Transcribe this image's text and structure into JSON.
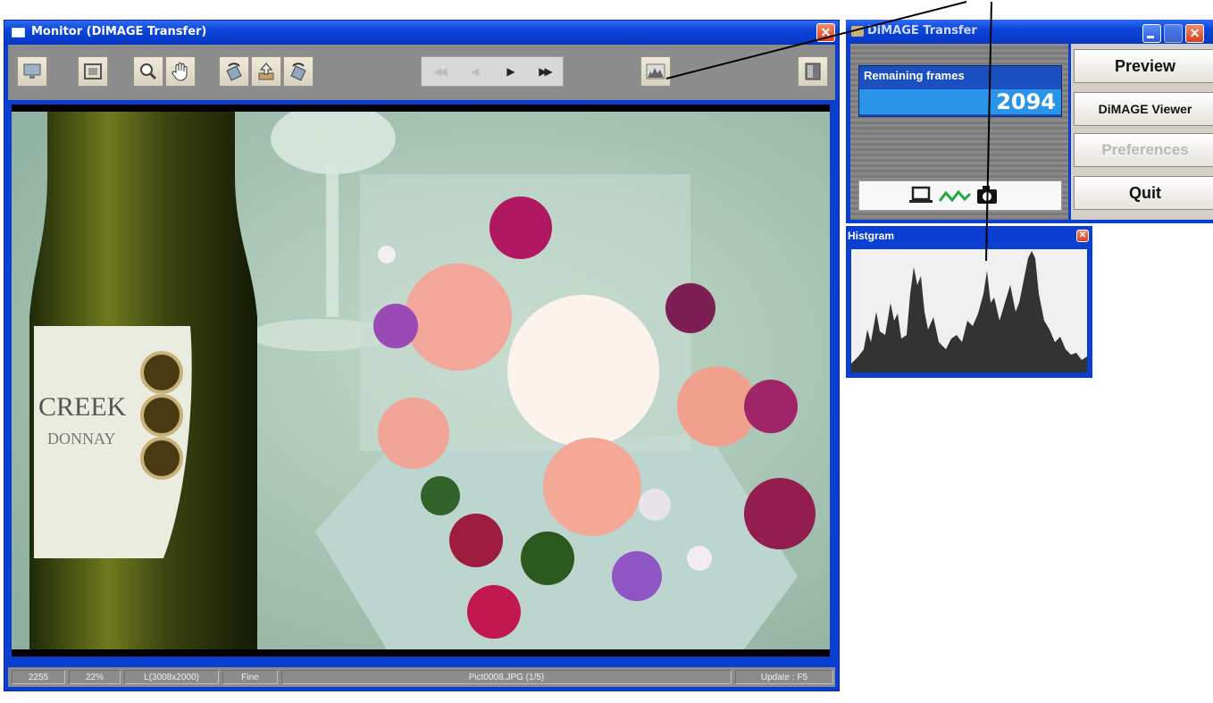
{
  "monitor": {
    "title": "Monitor (DiMAGE Transfer)",
    "toolbar_icons": [
      "display-icon",
      "fit-screen-icon",
      "zoom-icon",
      "hand-icon",
      "rotate-left-icon",
      "upload-icon",
      "rotate-right-icon",
      "histogram-icon",
      "panel-icon"
    ],
    "nav": {
      "first": "◀◀",
      "prev": "◀",
      "next": "▶",
      "last": "▶▶"
    },
    "status": {
      "count": "2255",
      "zoom": "22%",
      "size": "L(3008x2000)",
      "quality": "Fine",
      "filename": "Pict0008.JPG (1/5)",
      "update": "Update : F5"
    }
  },
  "transfer": {
    "title": "DiMAGE Transfer",
    "remaining_label": "Remaining frames",
    "remaining_value": "2094",
    "buttons": {
      "preview": "Preview",
      "viewer": "DiMAGE Viewer",
      "preferences": "Preferences",
      "quit": "Quit"
    },
    "connection_icons": [
      "computer-icon",
      "signal-icon",
      "camera-icon"
    ]
  },
  "histogram": {
    "title": "Histgram"
  },
  "colors": {
    "titlebar_blue": "#0c45d8",
    "remaining_blue": "#2a95e8",
    "close_red": "#d9401c",
    "toolbar_gray": "#8c8c8c",
    "signal_green": "#22aa44"
  }
}
